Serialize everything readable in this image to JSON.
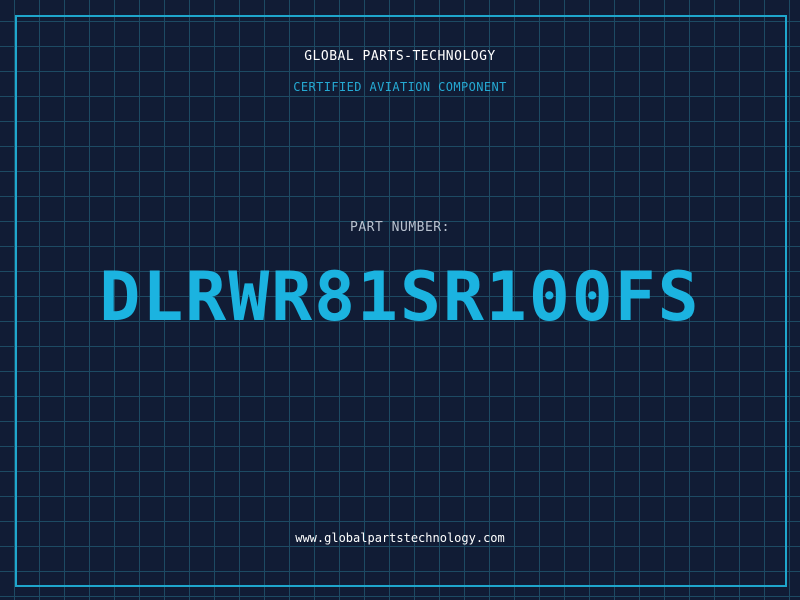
{
  "header": {
    "company": "GLOBAL PARTS-TECHNOLOGY",
    "subtitle": "CERTIFIED AVIATION COMPONENT"
  },
  "part": {
    "label": "PART NUMBER:",
    "number": "DLRWR81SR100FS"
  },
  "footer": {
    "website": "www.globalpartstechnology.com"
  },
  "colors": {
    "background": "#111c35",
    "grid": "#1d4a63",
    "accent": "#1bb3e0",
    "frame": "#1fa6cc"
  }
}
